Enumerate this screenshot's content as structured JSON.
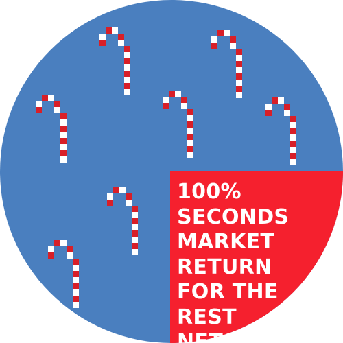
{
  "colors": {
    "background_circle": "#4a7fbf",
    "promo_panel": "#f5202e",
    "cane_red": "#d81f28",
    "cane_white": "#ffffff",
    "text": "#ffffff"
  },
  "decorations": {
    "icon": "candy-cane-icon",
    "count": 7
  },
  "promo": {
    "lines": [
      "100%",
      "SECONDS",
      "MARKET",
      "RETURN",
      "FOR THE",
      "REST",
      "NFTS!"
    ]
  }
}
